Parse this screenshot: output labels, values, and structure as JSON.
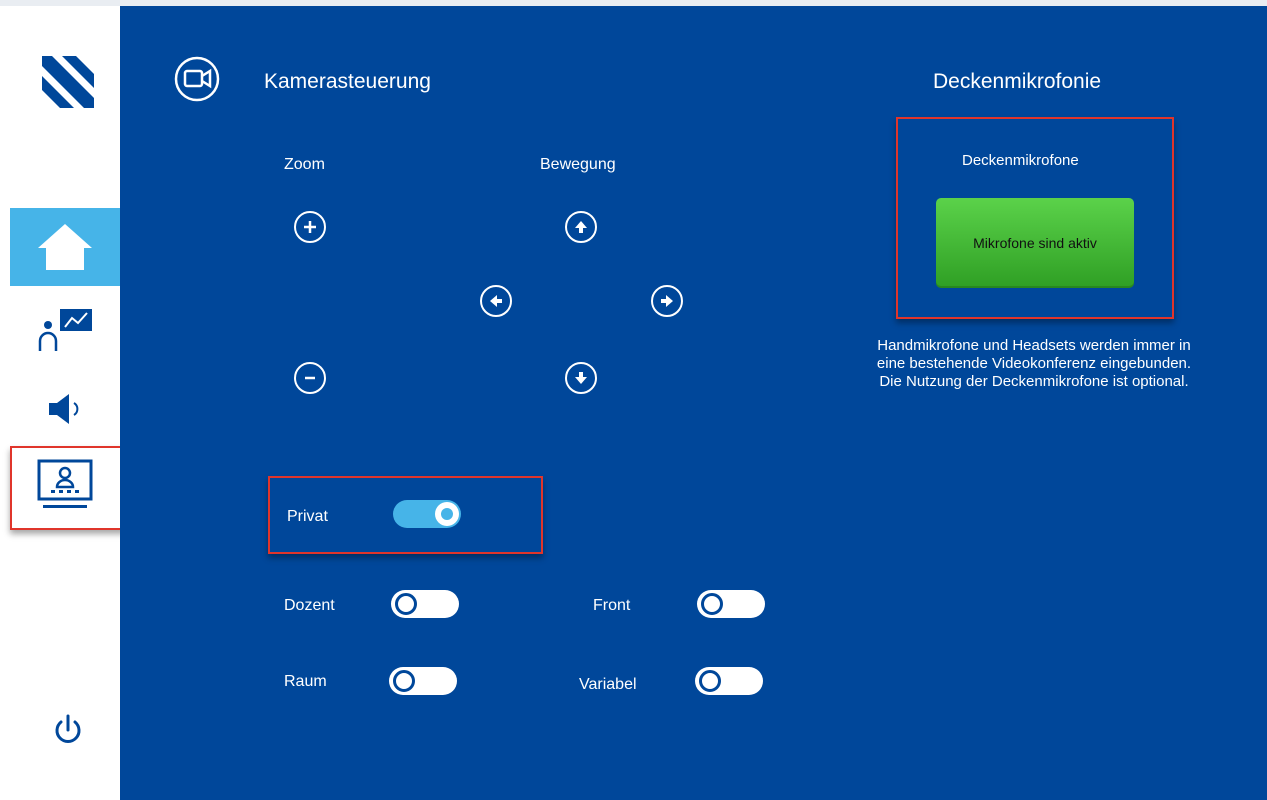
{
  "colors": {
    "main_bg": "#00479a",
    "accent": "#46b4e8",
    "highlight": "#e0352b",
    "green": "#3cb52e"
  },
  "sidebar": {
    "items": [
      {
        "name": "home",
        "icon": "home-icon"
      },
      {
        "name": "presenter",
        "icon": "presenter-chart-icon"
      },
      {
        "name": "audio",
        "icon": "speaker-icon"
      },
      {
        "name": "videoconference",
        "icon": "videoconference-icon"
      }
    ],
    "power_icon": "power-icon"
  },
  "camera": {
    "title": "Kamerasteuerung",
    "zoom_label": "Zoom",
    "movement_label": "Bewegung"
  },
  "toggles": {
    "privat": {
      "label": "Privat",
      "on": true
    },
    "dozent": {
      "label": "Dozent",
      "on": false
    },
    "front": {
      "label": "Front",
      "on": false
    },
    "raum": {
      "label": "Raum",
      "on": false
    },
    "variabel": {
      "label": "Variabel",
      "on": false
    }
  },
  "mics": {
    "title": "Deckenmikrofonie",
    "panel_label": "Deckenmikrofone",
    "button_label": "Mikrofone sind aktiv",
    "note_lines": [
      "Handmikrofone und Headsets werden immer in",
      "eine bestehende Videokonferenz eingebunden.",
      "Die Nutzung der Deckenmikrofone ist optional."
    ]
  }
}
